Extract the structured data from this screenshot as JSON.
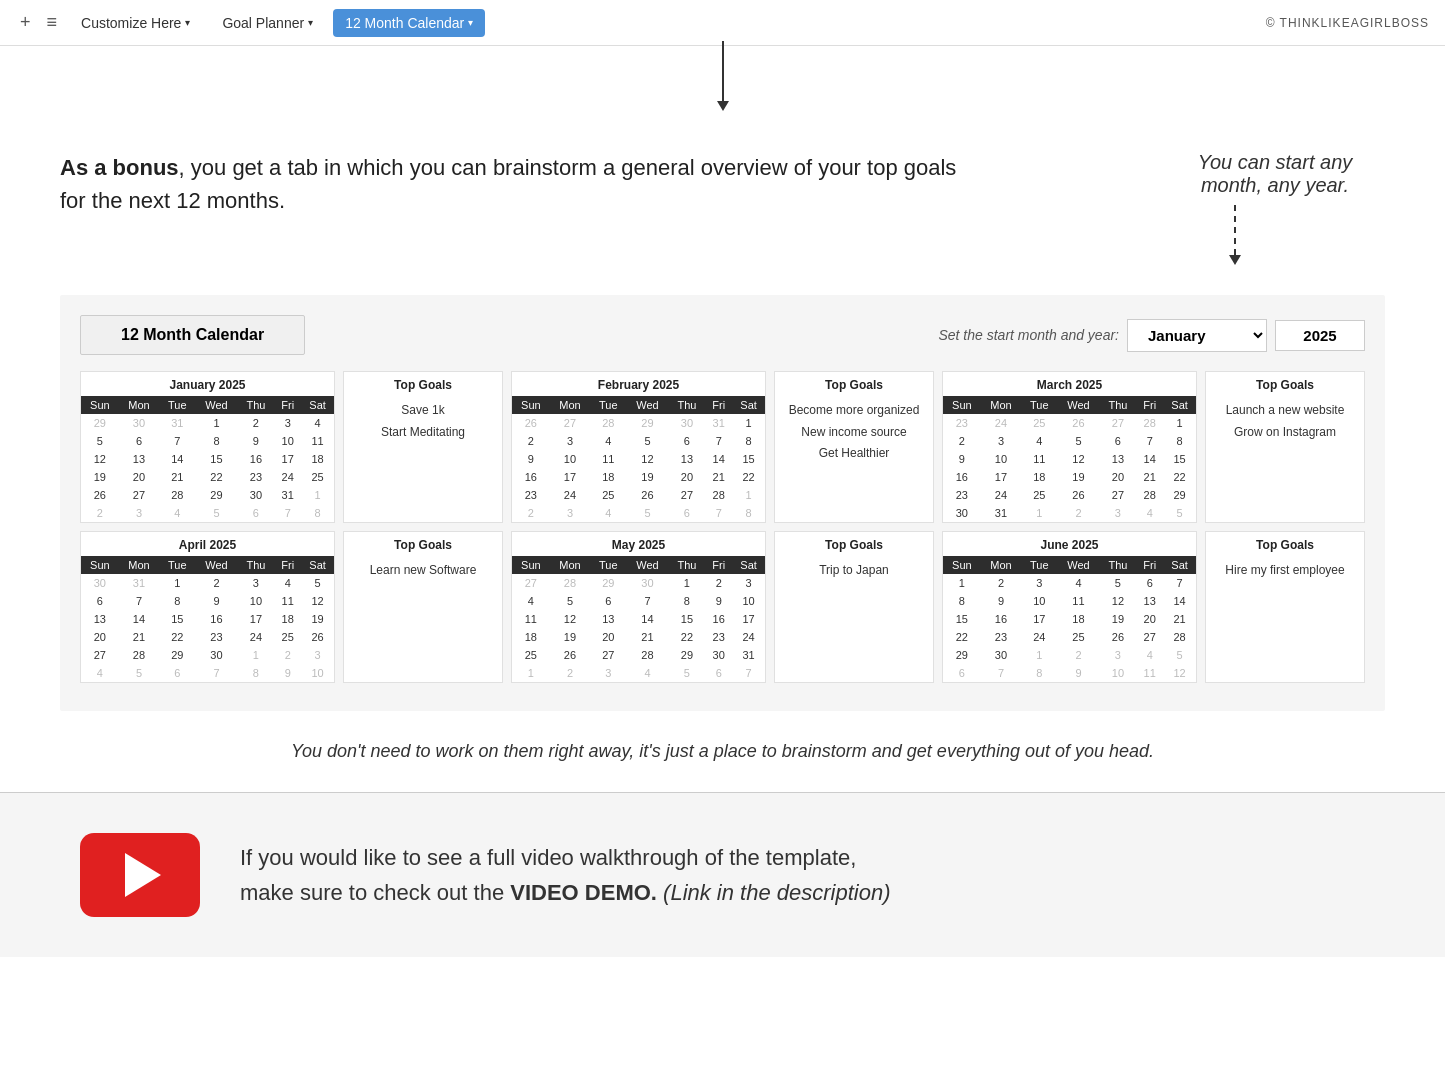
{
  "nav": {
    "add_icon": "+",
    "menu_icon": "≡",
    "customize_label": "Customize Here",
    "goal_planner_label": "Goal Planner",
    "calendar_label": "12 Month Calendar",
    "copyright": "© THINKLIKEAGIRLBOSS"
  },
  "intro": {
    "text_bold": "As a bonus",
    "text_rest": ", you get a tab in which you can brainstorm a general overview of your top goals for the next 12 months.",
    "side_note_line1": "You can start any",
    "side_note_line2": "month, any year."
  },
  "calendar_header": {
    "title": "12 Month Calendar",
    "controls_label": "Set the start month and year:",
    "selected_month": "January",
    "selected_year": "2025"
  },
  "months": [
    {
      "name": "January 2025",
      "days_header": [
        "Sun",
        "Mon",
        "Tue",
        "Wed",
        "Thu",
        "Fri",
        "Sat"
      ],
      "weeks": [
        [
          "29",
          "30",
          "31",
          "1",
          "2",
          "3",
          "4"
        ],
        [
          "5",
          "6",
          "7",
          "8",
          "9",
          "10",
          "11"
        ],
        [
          "12",
          "13",
          "14",
          "15",
          "16",
          "17",
          "18"
        ],
        [
          "19",
          "20",
          "21",
          "22",
          "23",
          "24",
          "25"
        ],
        [
          "26",
          "27",
          "28",
          "29",
          "30",
          "31",
          "1"
        ],
        [
          "2",
          "3",
          "4",
          "5",
          "6",
          "7",
          "8"
        ]
      ],
      "other_start": [
        true,
        true,
        true,
        false,
        false,
        false,
        false
      ],
      "other_end_row5": [
        false,
        false,
        false,
        false,
        false,
        false,
        true
      ],
      "other_end_row6": [
        true,
        true,
        true,
        true,
        true,
        true,
        true
      ],
      "goals": [
        "Save 1k",
        "Start Meditating"
      ]
    },
    {
      "name": "February 2025",
      "days_header": [
        "Sun",
        "Mon",
        "Tue",
        "Wed",
        "Thu",
        "Fri",
        "Sat"
      ],
      "weeks": [
        [
          "26",
          "27",
          "28",
          "29",
          "30",
          "31",
          "1"
        ],
        [
          "2",
          "3",
          "4",
          "5",
          "6",
          "7",
          "8"
        ],
        [
          "9",
          "10",
          "11",
          "12",
          "13",
          "14",
          "15"
        ],
        [
          "16",
          "17",
          "18",
          "19",
          "20",
          "21",
          "22"
        ],
        [
          "23",
          "24",
          "25",
          "26",
          "27",
          "28",
          "1"
        ],
        [
          "2",
          "3",
          "4",
          "5",
          "6",
          "7",
          "8"
        ]
      ],
      "goals": [
        "Become more organized",
        "New income source",
        "Get Healthier"
      ]
    },
    {
      "name": "March 2025",
      "days_header": [
        "Sun",
        "Mon",
        "Tue",
        "Wed",
        "Thu",
        "Fri",
        "Sat"
      ],
      "weeks": [
        [
          "23",
          "24",
          "25",
          "26",
          "27",
          "28",
          "1"
        ],
        [
          "2",
          "3",
          "4",
          "5",
          "6",
          "7",
          "8"
        ],
        [
          "9",
          "10",
          "11",
          "12",
          "13",
          "14",
          "15"
        ],
        [
          "16",
          "17",
          "18",
          "19",
          "20",
          "21",
          "22"
        ],
        [
          "23",
          "24",
          "25",
          "26",
          "27",
          "28",
          "29"
        ],
        [
          "30",
          "31",
          "1",
          "2",
          "3",
          "4",
          "5"
        ]
      ],
      "goals": [
        "Launch a new website",
        "Grow on Instagram"
      ]
    },
    {
      "name": "April 2025",
      "days_header": [
        "Sun",
        "Mon",
        "Tue",
        "Wed",
        "Thu",
        "Fri",
        "Sat"
      ],
      "weeks": [
        [
          "30",
          "31",
          "1",
          "2",
          "3",
          "4",
          "5"
        ],
        [
          "6",
          "7",
          "8",
          "9",
          "10",
          "11",
          "12"
        ],
        [
          "13",
          "14",
          "15",
          "16",
          "17",
          "18",
          "19"
        ],
        [
          "20",
          "21",
          "22",
          "23",
          "24",
          "25",
          "26"
        ],
        [
          "27",
          "28",
          "29",
          "30",
          "1",
          "2",
          "3"
        ],
        [
          "4",
          "5",
          "6",
          "7",
          "8",
          "9",
          "10"
        ]
      ],
      "goals": [
        "Learn new Software"
      ]
    },
    {
      "name": "May 2025",
      "days_header": [
        "Sun",
        "Mon",
        "Tue",
        "Wed",
        "Thu",
        "Fri",
        "Sat"
      ],
      "weeks": [
        [
          "27",
          "28",
          "29",
          "30",
          "1",
          "2",
          "3"
        ],
        [
          "4",
          "5",
          "6",
          "7",
          "8",
          "9",
          "10"
        ],
        [
          "11",
          "12",
          "13",
          "14",
          "15",
          "16",
          "17"
        ],
        [
          "18",
          "19",
          "20",
          "21",
          "22",
          "23",
          "24"
        ],
        [
          "25",
          "26",
          "27",
          "28",
          "29",
          "30",
          "31"
        ],
        [
          "1",
          "2",
          "3",
          "4",
          "5",
          "6",
          "7"
        ]
      ],
      "goals": [
        "Trip to Japan"
      ]
    },
    {
      "name": "June 2025",
      "days_header": [
        "Sun",
        "Mon",
        "Tue",
        "Wed",
        "Thu",
        "Fri",
        "Sat"
      ],
      "weeks": [
        [
          "1",
          "2",
          "3",
          "4",
          "5",
          "6",
          "7"
        ],
        [
          "8",
          "9",
          "10",
          "11",
          "12",
          "13",
          "14"
        ],
        [
          "15",
          "16",
          "17",
          "18",
          "19",
          "20",
          "21"
        ],
        [
          "22",
          "23",
          "24",
          "25",
          "26",
          "27",
          "28"
        ],
        [
          "29",
          "30",
          "1",
          "2",
          "3",
          "4",
          "5"
        ],
        [
          "6",
          "7",
          "8",
          "9",
          "10",
          "11",
          "12"
        ]
      ],
      "goals": [
        "Hire my first employee"
      ]
    }
  ],
  "bottom_italic": "You don't need to work on them right away, it's just a place to brainstorm and get everything out of you head.",
  "footer": {
    "text_before_bold": "If you would like to see a full video walkthrough of the template,\nmake sure to check out the ",
    "text_bold": "VIDEO DEMO.",
    "text_italic": " (Link in the description)"
  }
}
